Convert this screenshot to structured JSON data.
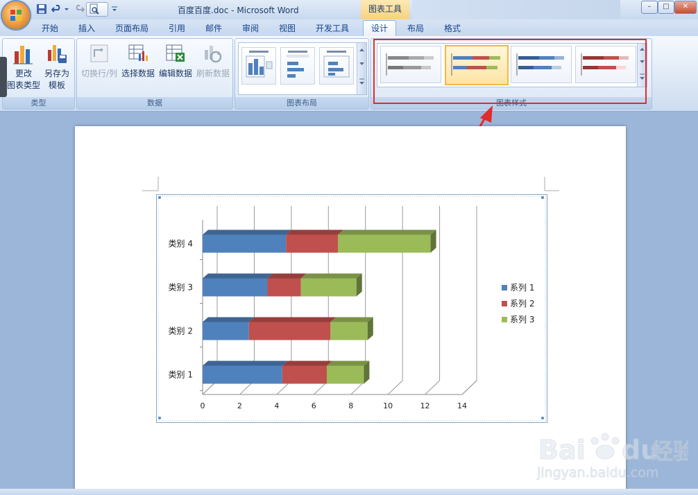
{
  "window": {
    "doc_title": "百度百度.doc - Microsoft Word",
    "context_tools_label": "图表工具",
    "minimize": "–",
    "restore": "□",
    "close": "✕"
  },
  "tabs": [
    "开始",
    "插入",
    "页面布局",
    "引用",
    "邮件",
    "审阅",
    "视图",
    "开发工具",
    "设计",
    "布局",
    "格式"
  ],
  "active_tab": "设计",
  "ribbon": {
    "group_type": {
      "label": "类型",
      "change_chart_type": [
        "更改",
        "图表类型"
      ],
      "save_as_template": [
        "另存为",
        "模板"
      ]
    },
    "group_data": {
      "label": "数据",
      "switch_row_col": "切换行/列",
      "select_data": "选择数据",
      "edit_data": "编辑数据",
      "refresh_data": "刷新数据"
    },
    "group_layout": {
      "label": "图表布局"
    },
    "group_style": {
      "label": "图表样式"
    }
  },
  "colors": {
    "series1": "#4f81bd",
    "series2": "#c0504d",
    "series3": "#9bbb59",
    "annotation": "#e22b2b"
  },
  "chart_data": {
    "type": "bar",
    "orientation": "horizontal",
    "stacked": true,
    "style": "3d",
    "categories": [
      "类别 1",
      "类别 2",
      "类别 3",
      "类别 4"
    ],
    "series": [
      {
        "name": "系列 1",
        "values": [
          4.3,
          2.5,
          3.5,
          4.5
        ]
      },
      {
        "name": "系列 2",
        "values": [
          2.4,
          4.4,
          1.8,
          2.8
        ]
      },
      {
        "name": "系列 3",
        "values": [
          2,
          2,
          3,
          5
        ]
      }
    ],
    "xlim": [
      0,
      14
    ],
    "xticks": [
      "0",
      "2",
      "4",
      "6",
      "8",
      "10",
      "12",
      "14"
    ],
    "grid": true,
    "legend": "right"
  },
  "watermark": {
    "brand": "Bai du 经验",
    "url": "jingyan.baidu.com"
  }
}
